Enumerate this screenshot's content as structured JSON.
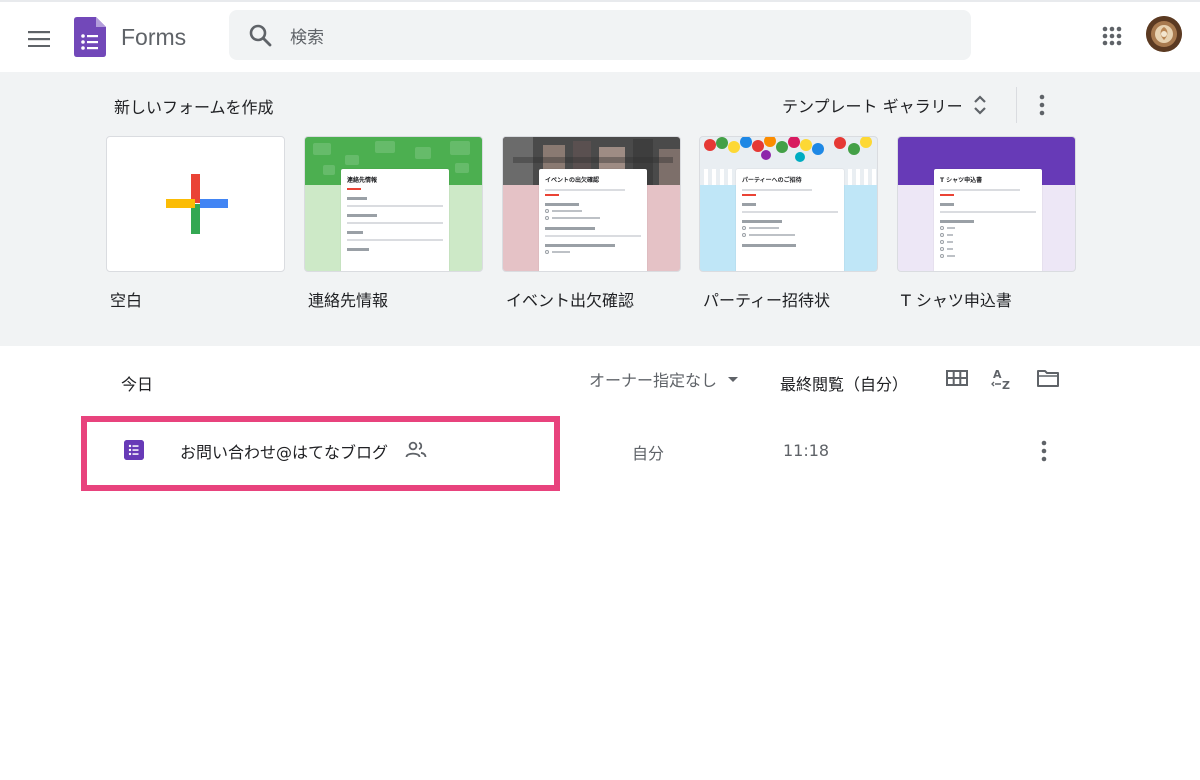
{
  "header": {
    "app_name": "Forms",
    "search_placeholder": "検索"
  },
  "gallery": {
    "title": "新しいフォームを作成",
    "toggle_label": "テンプレート ギャラリー",
    "templates": [
      {
        "label": "空白"
      },
      {
        "label": "連絡先情報",
        "preview_title": "連絡先情報",
        "accent": "#4caf50"
      },
      {
        "label": "イベント出欠確認",
        "preview_title": "イベントの出欠確認",
        "accent": "#e5c2c6"
      },
      {
        "label": "パーティー招待状",
        "preview_title": "パーティーへのご招待",
        "accent": "#bfe6f7"
      },
      {
        "label": "T シャツ申込書",
        "preview_title": "T シャツ申込書",
        "accent": "#673ab7"
      }
    ]
  },
  "documents": {
    "section_label": "今日",
    "owner_filter": "オーナー指定なし",
    "sort_label": "最終閲覧（自分）",
    "items": [
      {
        "title": "お問い合わせ@はてなブログ",
        "owner": "自分",
        "time": "11:18"
      }
    ]
  },
  "colors": {
    "forms_purple": "#673ab7",
    "highlight": "#e8437d",
    "gallery_bg": "#f1f3f4"
  }
}
